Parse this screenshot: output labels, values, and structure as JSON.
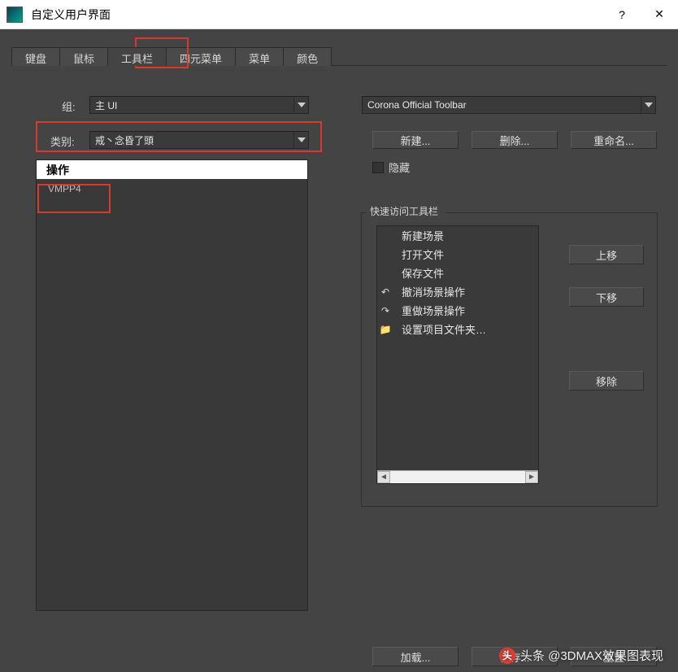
{
  "titlebar": {
    "title": "自定义用户界面",
    "help": "?",
    "close": "✕"
  },
  "tabs": [
    "键盘",
    "鼠标",
    "工具栏",
    "四元菜单",
    "菜单",
    "颜色"
  ],
  "active_tab_index": 2,
  "group_label": "组:",
  "group_value": "主 UI",
  "category_label": "类别:",
  "category_value": "戒丶念昏了頭",
  "actions_header": "操作",
  "actions": [
    "VMPP4"
  ],
  "toolbar_select": "Corona Official Toolbar",
  "buttons": {
    "new": "新建...",
    "delete": "删除...",
    "rename": "重命名..."
  },
  "hide_checkbox": "隐藏",
  "quick_access": {
    "title": "快速访问工具栏",
    "items": [
      {
        "icon": "",
        "label": "新建场景"
      },
      {
        "icon": "",
        "label": "打开文件"
      },
      {
        "icon": "",
        "label": "保存文件"
      },
      {
        "icon": "↶",
        "label": "撤消场景操作"
      },
      {
        "icon": "↷",
        "label": "重做场景操作"
      },
      {
        "icon": "📁",
        "label": "设置项目文件夹…"
      }
    ],
    "btn_up": "上移",
    "btn_down": "下移",
    "btn_remove": "移除"
  },
  "bottom_buttons": {
    "load": "加载...",
    "save": "保存...",
    "reset": "重置"
  },
  "watermark": "头条 @3DMAX效果图表现"
}
